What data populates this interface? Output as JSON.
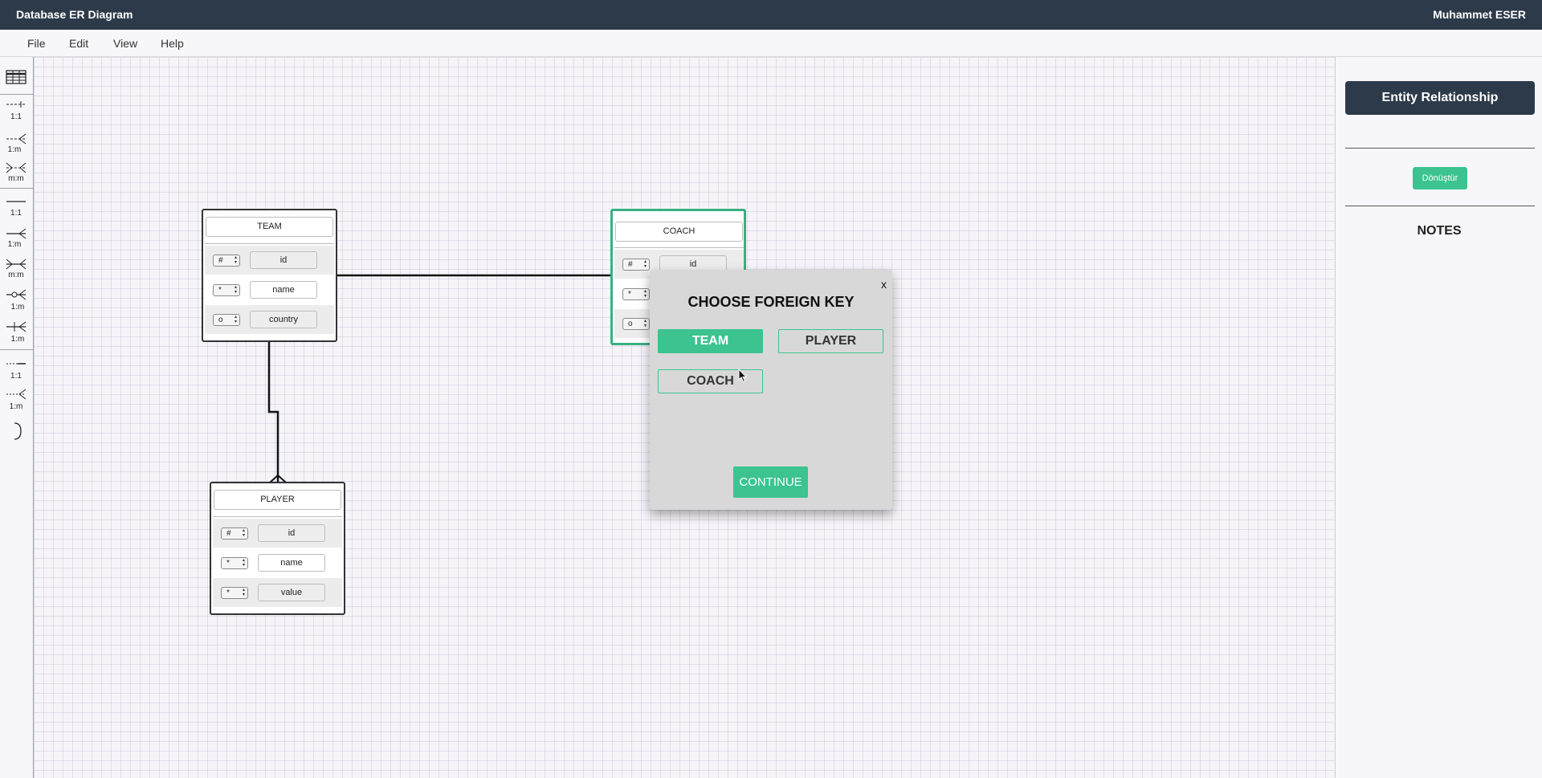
{
  "app": {
    "title": "Database ER Diagram",
    "user": "Muhammet ESER"
  },
  "menu": [
    "File",
    "Edit",
    "View",
    "Help"
  ],
  "toolbar": {
    "labels": [
      "1:1",
      "1:m",
      "m:m",
      "1:1",
      "1:m",
      "m:m",
      "1:m",
      "1:m",
      "1:1",
      "1:m"
    ]
  },
  "entities": {
    "team": {
      "title": "TEAM",
      "rows": [
        {
          "key": "#",
          "name": "id"
        },
        {
          "key": "*",
          "name": "name"
        },
        {
          "key": "o",
          "name": "country"
        }
      ]
    },
    "coach": {
      "title": "COACH",
      "rows": [
        {
          "key": "#",
          "name": "id"
        },
        {
          "key": "*",
          "name": ""
        },
        {
          "key": "o",
          "name": ""
        }
      ]
    },
    "player": {
      "title": "PLAYER",
      "rows": [
        {
          "key": "#",
          "name": "id"
        },
        {
          "key": "*",
          "name": "name"
        },
        {
          "key": "*",
          "name": "value"
        }
      ]
    }
  },
  "sidepanel": {
    "er_label": "Entity Relationship",
    "convert_label": "Dönüştür",
    "notes_title": "NOTES"
  },
  "dialog": {
    "title": "CHOOSE FOREIGN KEY",
    "close": "x",
    "options": [
      "TEAM",
      "PLAYER",
      "COACH"
    ],
    "selected": "TEAM",
    "continue_label": "CONTINUE"
  },
  "colors": {
    "accent": "#3cc390",
    "topbar": "#2c3a4a"
  }
}
